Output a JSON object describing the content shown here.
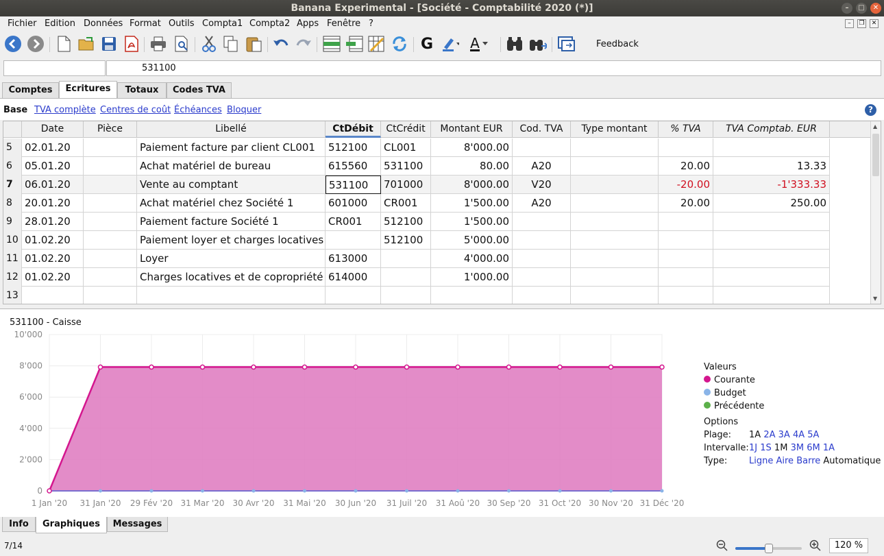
{
  "window": {
    "title": "Banana Experimental - [Société - Comptabilité 2020 (*)]"
  },
  "menu": [
    "Fichier",
    "Edition",
    "Données",
    "Format",
    "Outils",
    "Compta1",
    "Compta2",
    "Apps",
    "Fenêtre",
    "?"
  ],
  "toolbar": {
    "feedback_label": "Feedback",
    "bold_label": "G",
    "textcolor_label": "A"
  },
  "cellbar": {
    "left_value": "",
    "value": "531100"
  },
  "tabs": [
    "Comptes",
    "Ecritures",
    "Totaux",
    "Codes TVA"
  ],
  "active_tab": "Ecritures",
  "views": {
    "current": "Base",
    "links": [
      "TVA complète",
      "Centres de coût",
      "Échéances",
      "Bloquer"
    ]
  },
  "table": {
    "headers": [
      "Date",
      "Pièce",
      "Libellé",
      "CtDébit",
      "CtCrédit",
      "Montant EUR",
      "Cod. TVA",
      "Type montant",
      "% TVA",
      "TVA Comptab. EUR"
    ],
    "rows": [
      {
        "n": "5",
        "date": "02.01.20",
        "piece": "",
        "libelle": "Paiement facture par client CL001",
        "debit": "512100",
        "credit": "CL001",
        "montant": "8'000.00",
        "codtva": "",
        "type": "",
        "pct": "",
        "tva": ""
      },
      {
        "n": "6",
        "date": "05.01.20",
        "piece": "",
        "libelle": "Achat matériel de bureau",
        "debit": "615560",
        "credit": "531100",
        "montant": "80.00",
        "codtva": "A20",
        "type": "",
        "pct": "20.00",
        "tva": "13.33"
      },
      {
        "n": "7",
        "date": "06.01.20",
        "piece": "",
        "libelle": "Vente au comptant",
        "debit": "531100",
        "credit": "701000",
        "montant": "8'000.00",
        "codtva": "V20",
        "type": "",
        "pct": "-20.00",
        "tva": "-1'333.33"
      },
      {
        "n": "8",
        "date": "20.01.20",
        "piece": "",
        "libelle": "Achat matériel chez Société 1",
        "debit": "601000",
        "credit": "CR001",
        "montant": "1'500.00",
        "codtva": "A20",
        "type": "",
        "pct": "20.00",
        "tva": "250.00"
      },
      {
        "n": "9",
        "date": "28.01.20",
        "piece": "",
        "libelle": "Paiement facture Société 1",
        "debit": "CR001",
        "credit": "512100",
        "montant": "1'500.00",
        "codtva": "",
        "type": "",
        "pct": "",
        "tva": ""
      },
      {
        "n": "10",
        "date": "01.02.20",
        "piece": "",
        "libelle": "Paiement loyer et charges locatives",
        "debit": "",
        "credit": "512100",
        "montant": "5'000.00",
        "codtva": "",
        "type": "",
        "pct": "",
        "tva": ""
      },
      {
        "n": "11",
        "date": "01.02.20",
        "piece": "",
        "libelle": "Loyer",
        "debit": "613000",
        "credit": "",
        "montant": "4'000.00",
        "codtva": "",
        "type": "",
        "pct": "",
        "tva": ""
      },
      {
        "n": "12",
        "date": "01.02.20",
        "piece": "",
        "libelle": "Charges locatives et de copropriété",
        "debit": "614000",
        "credit": "",
        "montant": "1'000.00",
        "codtva": "",
        "type": "",
        "pct": "",
        "tva": ""
      },
      {
        "n": "13",
        "date": "",
        "piece": "",
        "libelle": "",
        "debit": "",
        "credit": "",
        "montant": "",
        "codtva": "",
        "type": "",
        "pct": "",
        "tva": ""
      }
    ]
  },
  "chart_data": {
    "type": "area",
    "title": "531100 - Caisse",
    "x": [
      "1 Jan '20",
      "31 Jan '20",
      "29 Fév '20",
      "31 Mar '20",
      "30 Avr '20",
      "31 Mai '20",
      "30 Jun '20",
      "31 Juil '20",
      "31 Aoû '20",
      "30 Sep '20",
      "31 Oct '20",
      "30 Nov '20",
      "31 Déc '20"
    ],
    "yticks": [
      "0",
      "2'000",
      "4'000",
      "6'000",
      "8'000",
      "10'000"
    ],
    "ylim": [
      0,
      10000
    ],
    "series": [
      {
        "name": "Courante",
        "color": "#d4168e",
        "values": [
          0,
          7920,
          7920,
          7920,
          7920,
          7920,
          7920,
          7920,
          7920,
          7920,
          7920,
          7920,
          7920
        ]
      },
      {
        "name": "Budget",
        "color": "#8ab4e8",
        "values": [
          0,
          0,
          0,
          0,
          0,
          0,
          0,
          0,
          0,
          0,
          0,
          0,
          0
        ]
      }
    ],
    "legend": {
      "title": "Valeurs",
      "items": [
        {
          "name": "Courante",
          "color": "#d4168e"
        },
        {
          "name": "Budget",
          "color": "#8ab4e8"
        },
        {
          "name": "Précédente",
          "color": "#5cb04a"
        }
      ]
    },
    "options": {
      "title": "Options",
      "plage_label": "Plage:",
      "plage": [
        "1A",
        "2A",
        "3A",
        "4A",
        "5A"
      ],
      "plage_selected": "1A",
      "intervalle_label": "Intervalle:",
      "intervalle": [
        "1J",
        "1S",
        "1M",
        "3M",
        "6M",
        "1A"
      ],
      "intervalle_selected": "1M",
      "type_label": "Type:",
      "type": [
        "Ligne",
        "Aire",
        "Barre",
        "Automatique"
      ],
      "type_selected": "Automatique"
    },
    "grid": true
  },
  "bottom_tabs": [
    "Info",
    "Graphiques",
    "Messages"
  ],
  "active_bottom_tab": "Graphiques",
  "status": {
    "position": "7/14",
    "zoom": "120 %",
    "zoom_level": 0.5
  }
}
